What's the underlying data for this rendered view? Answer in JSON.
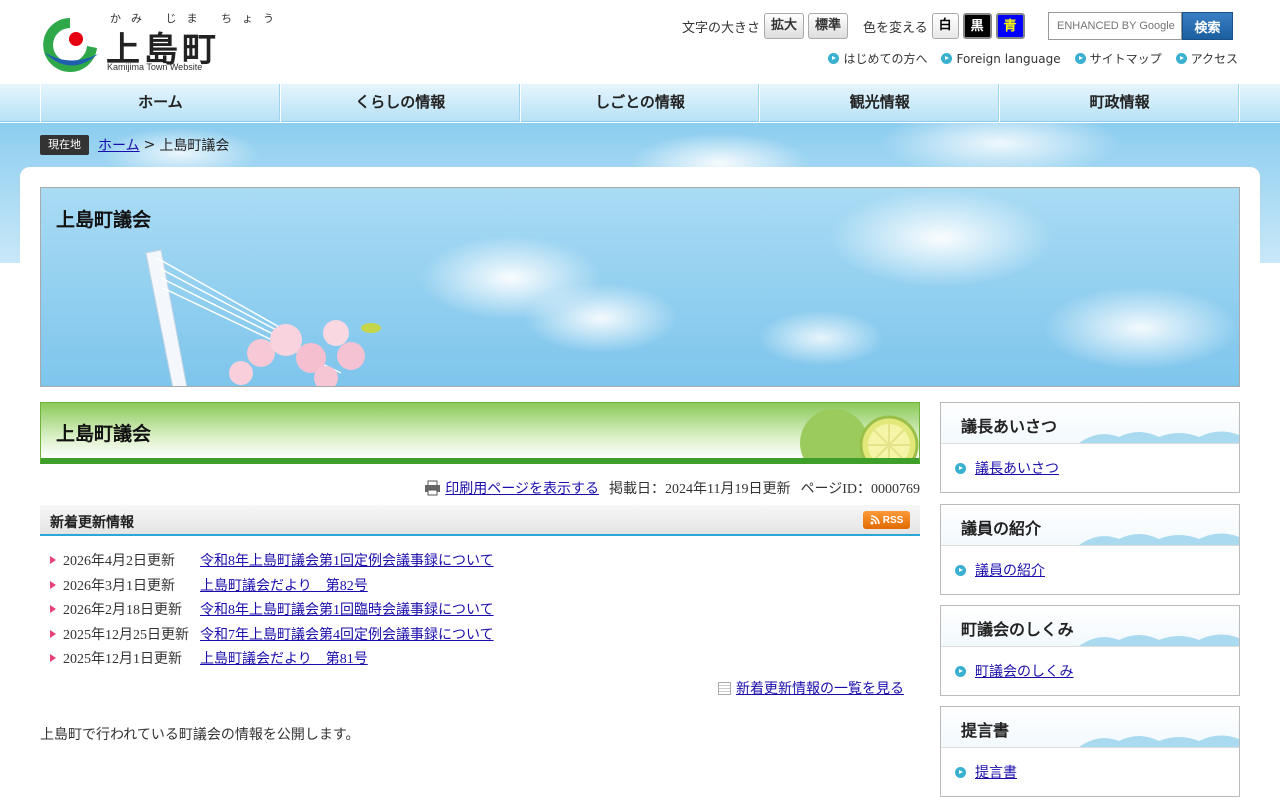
{
  "header": {
    "logo_ruby": "かみ じま ちょう",
    "logo_name": "上島町",
    "logo_sub": "Kamijima Town Website",
    "font_size_label": "文字の大きさ",
    "font_enlarge": "拡大",
    "font_standard": "標準",
    "color_label": "色を変える",
    "color_white": "白",
    "color_black": "黒",
    "color_blue": "青",
    "search_placeholder": "ENHANCED BY Google",
    "search_button": "検索",
    "sublinks": [
      {
        "label": "はじめての方へ"
      },
      {
        "label": "Foreign language"
      },
      {
        "label": "サイトマップ"
      },
      {
        "label": "アクセス"
      }
    ]
  },
  "nav": {
    "items": [
      {
        "label": "ホーム"
      },
      {
        "label": "くらしの情報"
      },
      {
        "label": "しごとの情報"
      },
      {
        "label": "観光情報"
      },
      {
        "label": "町政情報"
      }
    ]
  },
  "breadcrumb": {
    "badge": "現在地",
    "home": "ホーム",
    "separator": ">",
    "current": "上島町議会"
  },
  "hero": {
    "title": "上島町議会"
  },
  "page": {
    "title": "上島町議会",
    "print_link": "印刷用ページを表示する",
    "posted": "掲載日：2024年11月19日更新",
    "page_id": "ページID：0000769",
    "intro": "上島町で行われている町議会の情報を公開します。"
  },
  "news": {
    "title": "新着更新情報",
    "rss": "RSS",
    "items": [
      {
        "date": "2026年4月2日更新",
        "title": "令和8年上島町議会第1回定例会議事録について"
      },
      {
        "date": "2026年3月1日更新",
        "title": "上島町議会だより　第82号"
      },
      {
        "date": "2026年2月18日更新",
        "title": "令和8年上島町議会第1回臨時会議事録について"
      },
      {
        "date": "2025年12月25日更新",
        "title": "令和7年上島町議会第4回定例会議事録について"
      },
      {
        "date": "2025年12月1日更新",
        "title": "上島町議会だより　第81号"
      }
    ],
    "more": "新着更新情報の一覧を見る"
  },
  "sidebar": {
    "boxes": [
      {
        "title": "議長あいさつ",
        "link": "議長あいさつ"
      },
      {
        "title": "議員の紹介",
        "link": "議員の紹介"
      },
      {
        "title": "町議会のしくみ",
        "link": "町議会のしくみ"
      },
      {
        "title": "提言書",
        "link": "提言書"
      }
    ]
  },
  "colors": {
    "accent_blue": "#29a8d8",
    "title_green": "#3ea02a",
    "link": "#1a0dab",
    "bullet_pink": "#e6417b"
  }
}
